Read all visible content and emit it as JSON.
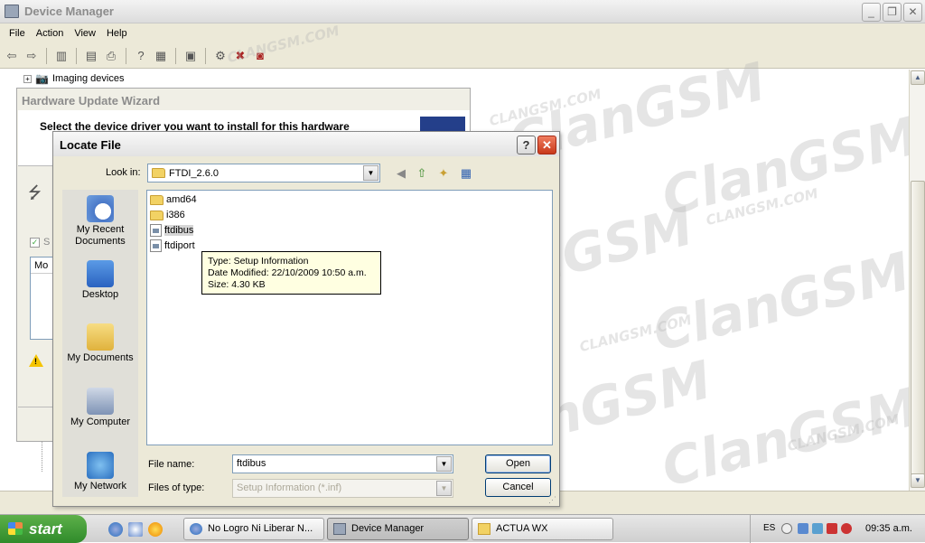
{
  "window": {
    "title": "Device Manager",
    "minimize_glyph": "_",
    "restore_glyph": "❐",
    "close_glyph": "✕"
  },
  "menu": [
    "File",
    "Action",
    "View",
    "Help"
  ],
  "toolbar_icons": [
    "back-icon",
    "forward-icon",
    "console-tree-icon",
    "properties-icon",
    "print-icon",
    "help-icon",
    "view-icon",
    "scan-hardware-icon",
    "update-driver-icon",
    "uninstall-icon",
    "disable-icon"
  ],
  "tree": {
    "expander": "+",
    "node_label": "Imaging devices"
  },
  "wizard": {
    "title": "Hardware Update Wizard",
    "heading": "Select the device driver you want to install for this hardware",
    "checkbox_fragment": "S",
    "list_header_fragment": "Mo"
  },
  "dialog": {
    "title": "Locate File",
    "help_glyph": "?",
    "close_glyph": "✕",
    "look_in_label": "Look in:",
    "look_in_value": "FTDI_2.6.0",
    "places": [
      "My Recent Documents",
      "Desktop",
      "My Documents",
      "My Computer",
      "My Network"
    ],
    "files": [
      {
        "name": "amd64",
        "kind": "folder"
      },
      {
        "name": "i386",
        "kind": "folder"
      },
      {
        "name": "ftdibus",
        "kind": "inf",
        "selected": true
      },
      {
        "name": "ftdiport",
        "kind": "inf"
      }
    ],
    "tooltip": {
      "type": "Type: Setup Information",
      "modified": "Date Modified: 22/10/2009 10:50 a.m.",
      "size": "Size: 4.30 KB"
    },
    "file_name_label": "File name:",
    "file_name_value": "ftdibus",
    "files_of_type_label": "Files of type:",
    "files_of_type_value": "Setup Information (*.inf)",
    "open_label": "Open",
    "cancel_label": "Cancel"
  },
  "taskbar": {
    "start_label": "start",
    "tasks": [
      {
        "label": "No Logro Ni Liberar N...",
        "active": false
      },
      {
        "label": "Device Manager",
        "active": true
      },
      {
        "label": "ACTUA WX",
        "active": false
      }
    ],
    "language": "ES",
    "clock": "09:35 a.m."
  },
  "watermark": {
    "big": "ClanGSM",
    "small": "CLANGSM.COM"
  },
  "colors": {
    "dialog_face": "#ece9d8",
    "start_green": "#3c9a34",
    "close_red": "#d4482a",
    "tooltip_bg": "#ffffe1"
  }
}
